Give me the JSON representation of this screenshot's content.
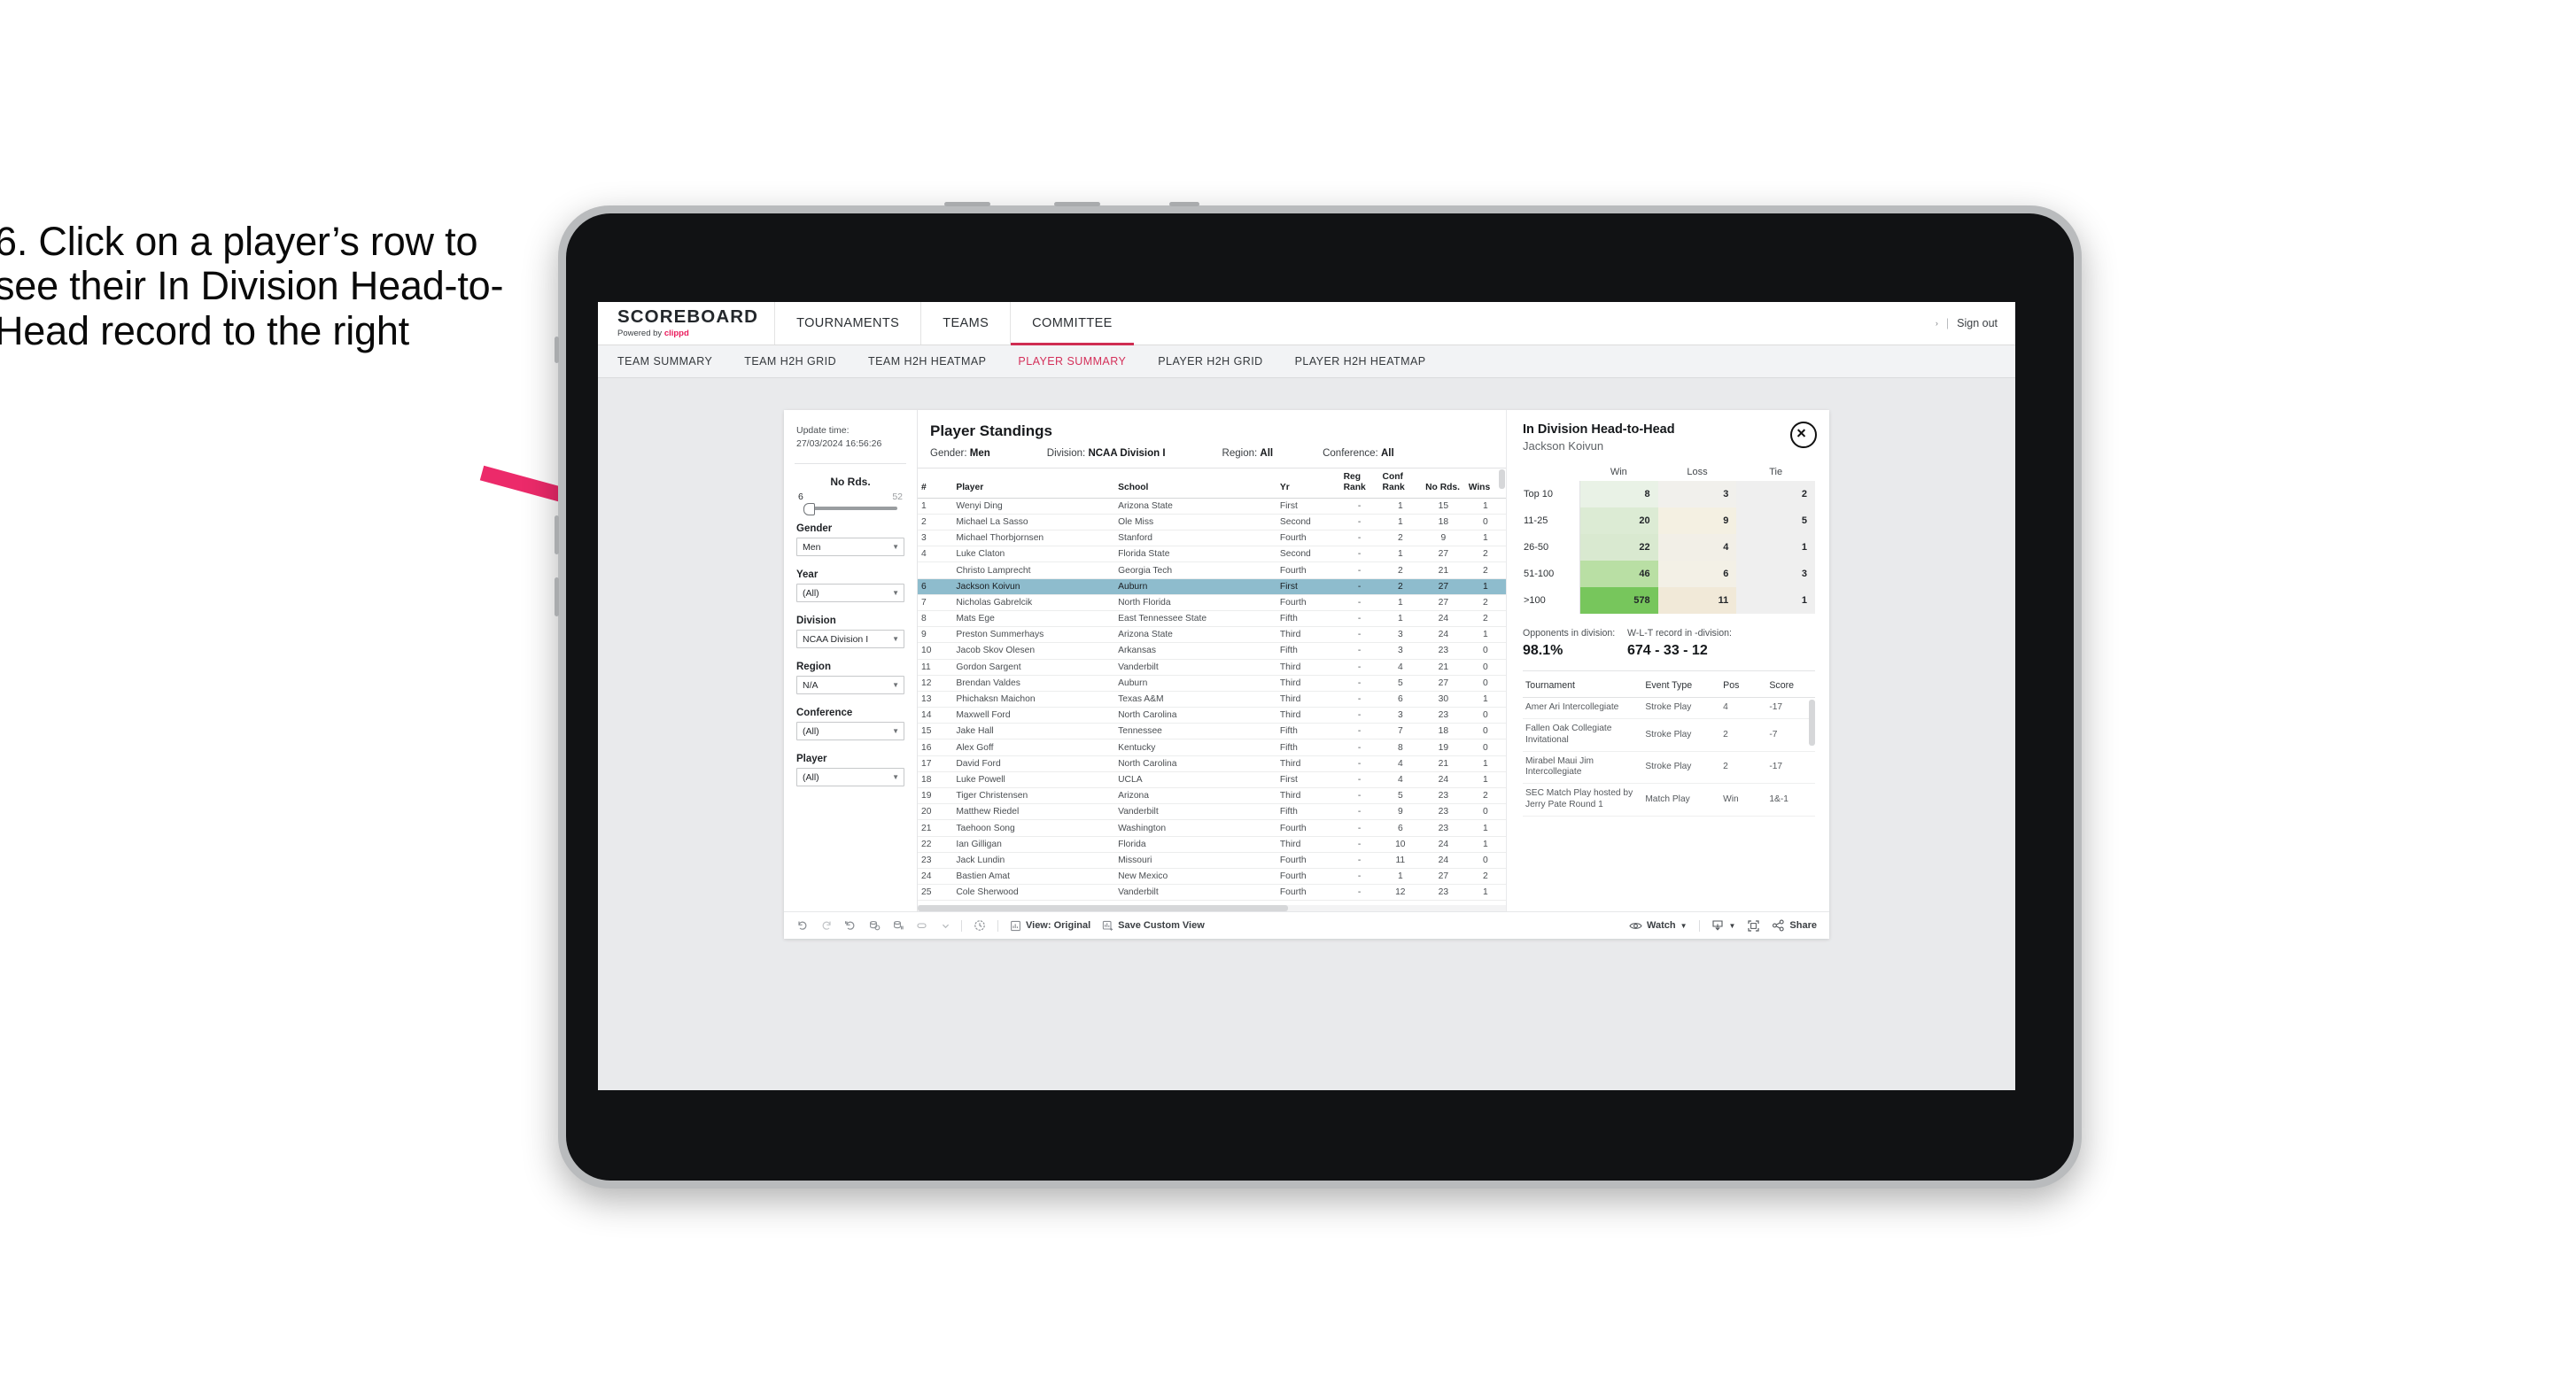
{
  "caption": "6. Click on a player’s row to see their In Division Head-to-Head record to the right",
  "header": {
    "brand_name": "SCOREBOARD",
    "brand_powered_prefix": "Powered by ",
    "brand_powered_name": "clippd",
    "nav": [
      {
        "label": "TOURNAMENTS",
        "active": false
      },
      {
        "label": "TEAMS",
        "active": false
      },
      {
        "label": "COMMITTEE",
        "active": true
      }
    ],
    "caret": "›",
    "separator": "|",
    "sign_out": "Sign out"
  },
  "subnav": [
    {
      "label": "TEAM SUMMARY",
      "active": false
    },
    {
      "label": "TEAM H2H GRID",
      "active": false
    },
    {
      "label": "TEAM H2H HEATMAP",
      "active": false
    },
    {
      "label": "PLAYER SUMMARY",
      "active": true
    },
    {
      "label": "PLAYER H2H GRID",
      "active": false
    },
    {
      "label": "PLAYER H2H HEATMAP",
      "active": false
    }
  ],
  "filters": {
    "update_label": "Update time:",
    "update_value": "27/03/2024 16:56:26",
    "slider": {
      "label": "No Rds.",
      "min": "6",
      "max": "52"
    },
    "controls": [
      {
        "label": "Gender",
        "value": "Men"
      },
      {
        "label": "Year",
        "value": "(All)"
      },
      {
        "label": "Division",
        "value": "NCAA Division I"
      },
      {
        "label": "Region",
        "value": "N/A"
      },
      {
        "label": "Conference",
        "value": "(All)"
      },
      {
        "label": "Player",
        "value": "(All)"
      }
    ]
  },
  "standings": {
    "title": "Player Standings",
    "meta": [
      {
        "label": "Gender:",
        "value": "Men"
      },
      {
        "label": "Division:",
        "value": "NCAA Division I"
      },
      {
        "label": "Region:",
        "value": "All"
      },
      {
        "label": "Conference:",
        "value": "All"
      }
    ],
    "columns": [
      "#",
      "Player",
      "School",
      "Yr",
      "Reg Rank",
      "Conf Rank",
      "No Rds.",
      "Wins"
    ],
    "rows": [
      {
        "num": "1",
        "player": "Wenyi Ding",
        "school": "Arizona State",
        "yr": "First",
        "reg": "-",
        "conf": "1",
        "rds": "15",
        "wins": "1",
        "selected": false
      },
      {
        "num": "2",
        "player": "Michael La Sasso",
        "school": "Ole Miss",
        "yr": "Second",
        "reg": "-",
        "conf": "1",
        "rds": "18",
        "wins": "0",
        "selected": false
      },
      {
        "num": "3",
        "player": "Michael Thorbjornsen",
        "school": "Stanford",
        "yr": "Fourth",
        "reg": "-",
        "conf": "2",
        "rds": "9",
        "wins": "1",
        "selected": false
      },
      {
        "num": "4",
        "player": "Luke Claton",
        "school": "Florida State",
        "yr": "Second",
        "reg": "-",
        "conf": "1",
        "rds": "27",
        "wins": "2",
        "selected": false
      },
      {
        "num": "",
        "player": "Christo Lamprecht",
        "school": "Georgia Tech",
        "yr": "Fourth",
        "reg": "-",
        "conf": "2",
        "rds": "21",
        "wins": "2",
        "selected": false
      },
      {
        "num": "6",
        "player": "Jackson Koivun",
        "school": "Auburn",
        "yr": "First",
        "reg": "-",
        "conf": "2",
        "rds": "27",
        "wins": "1",
        "selected": true
      },
      {
        "num": "7",
        "player": "Nicholas Gabrelcik",
        "school": "North Florida",
        "yr": "Fourth",
        "reg": "-",
        "conf": "1",
        "rds": "27",
        "wins": "2",
        "selected": false
      },
      {
        "num": "8",
        "player": "Mats Ege",
        "school": "East Tennessee State",
        "yr": "Fifth",
        "reg": "-",
        "conf": "1",
        "rds": "24",
        "wins": "2",
        "selected": false
      },
      {
        "num": "9",
        "player": "Preston Summerhays",
        "school": "Arizona State",
        "yr": "Third",
        "reg": "-",
        "conf": "3",
        "rds": "24",
        "wins": "1",
        "selected": false
      },
      {
        "num": "10",
        "player": "Jacob Skov Olesen",
        "school": "Arkansas",
        "yr": "Fifth",
        "reg": "-",
        "conf": "3",
        "rds": "23",
        "wins": "0",
        "selected": false
      },
      {
        "num": "11",
        "player": "Gordon Sargent",
        "school": "Vanderbilt",
        "yr": "Third",
        "reg": "-",
        "conf": "4",
        "rds": "21",
        "wins": "0",
        "selected": false
      },
      {
        "num": "12",
        "player": "Brendan Valdes",
        "school": "Auburn",
        "yr": "Third",
        "reg": "-",
        "conf": "5",
        "rds": "27",
        "wins": "0",
        "selected": false
      },
      {
        "num": "13",
        "player": "Phichaksn Maichon",
        "school": "Texas A&M",
        "yr": "Third",
        "reg": "-",
        "conf": "6",
        "rds": "30",
        "wins": "1",
        "selected": false
      },
      {
        "num": "14",
        "player": "Maxwell Ford",
        "school": "North Carolina",
        "yr": "Third",
        "reg": "-",
        "conf": "3",
        "rds": "23",
        "wins": "0",
        "selected": false
      },
      {
        "num": "15",
        "player": "Jake Hall",
        "school": "Tennessee",
        "yr": "Fifth",
        "reg": "-",
        "conf": "7",
        "rds": "18",
        "wins": "0",
        "selected": false
      },
      {
        "num": "16",
        "player": "Alex Goff",
        "school": "Kentucky",
        "yr": "Fifth",
        "reg": "-",
        "conf": "8",
        "rds": "19",
        "wins": "0",
        "selected": false
      },
      {
        "num": "17",
        "player": "David Ford",
        "school": "North Carolina",
        "yr": "Third",
        "reg": "-",
        "conf": "4",
        "rds": "21",
        "wins": "1",
        "selected": false
      },
      {
        "num": "18",
        "player": "Luke Powell",
        "school": "UCLA",
        "yr": "First",
        "reg": "-",
        "conf": "4",
        "rds": "24",
        "wins": "1",
        "selected": false
      },
      {
        "num": "19",
        "player": "Tiger Christensen",
        "school": "Arizona",
        "yr": "Third",
        "reg": "-",
        "conf": "5",
        "rds": "23",
        "wins": "2",
        "selected": false
      },
      {
        "num": "20",
        "player": "Matthew Riedel",
        "school": "Vanderbilt",
        "yr": "Fifth",
        "reg": "-",
        "conf": "9",
        "rds": "23",
        "wins": "0",
        "selected": false
      },
      {
        "num": "21",
        "player": "Taehoon Song",
        "school": "Washington",
        "yr": "Fourth",
        "reg": "-",
        "conf": "6",
        "rds": "23",
        "wins": "1",
        "selected": false
      },
      {
        "num": "22",
        "player": "Ian Gilligan",
        "school": "Florida",
        "yr": "Third",
        "reg": "-",
        "conf": "10",
        "rds": "24",
        "wins": "1",
        "selected": false
      },
      {
        "num": "23",
        "player": "Jack Lundin",
        "school": "Missouri",
        "yr": "Fourth",
        "reg": "-",
        "conf": "11",
        "rds": "24",
        "wins": "0",
        "selected": false
      },
      {
        "num": "24",
        "player": "Bastien Amat",
        "school": "New Mexico",
        "yr": "Fourth",
        "reg": "-",
        "conf": "1",
        "rds": "27",
        "wins": "2",
        "selected": false
      },
      {
        "num": "25",
        "player": "Cole Sherwood",
        "school": "Vanderbilt",
        "yr": "Fourth",
        "reg": "-",
        "conf": "12",
        "rds": "23",
        "wins": "1",
        "selected": false
      }
    ]
  },
  "h2h": {
    "title": "In Division Head-to-Head",
    "player": "Jackson Koivun",
    "close_icon": "close-icon",
    "columns": [
      "",
      "Win",
      "Loss",
      "Tie"
    ],
    "rows": [
      {
        "band": "Top 10",
        "win": "8",
        "loss": "3",
        "tie": "2",
        "win_color": "#e9f2e6",
        "loss_color": "#f1f0ec",
        "tie_color": "#efefef"
      },
      {
        "band": "11-25",
        "win": "20",
        "loss": "9",
        "tie": "5",
        "win_color": "#dcebd4",
        "loss_color": "#f4f0e2",
        "tie_color": "#efefef"
      },
      {
        "band": "26-50",
        "win": "22",
        "loss": "4",
        "tie": "1",
        "win_color": "#d9e9d0",
        "loss_color": "#f2efe7",
        "tie_color": "#efefef"
      },
      {
        "band": "51-100",
        "win": "46",
        "loss": "6",
        "tie": "3",
        "win_color": "#b9dfa4",
        "loss_color": "#f3f0e6",
        "tie_color": "#efefef"
      },
      {
        "band": ">100",
        "win": "578",
        "loss": "11",
        "tie": "1",
        "win_color": "#77c65c",
        "loss_color": "#f1e9d8",
        "tie_color": "#efefef"
      }
    ],
    "stats": [
      {
        "label": "Opponents in division:",
        "value": "98.1%"
      },
      {
        "label": "W-L-T record in -division:",
        "value": "674 - 33 - 12"
      }
    ],
    "tournament_columns": [
      "Tournament",
      "Event Type",
      "Pos",
      "Score"
    ],
    "tournaments": [
      {
        "name": "Amer Ari Intercollegiate",
        "type": "Stroke Play",
        "pos": "4",
        "score": "-17"
      },
      {
        "name": "Fallen Oak Collegiate Invitational",
        "type": "Stroke Play",
        "pos": "2",
        "score": "-7"
      },
      {
        "name": "Mirabel Maui Jim Intercollegiate",
        "type": "Stroke Play",
        "pos": "2",
        "score": "-17"
      },
      {
        "name": "SEC Match Play hosted by Jerry Pate Round 1",
        "type": "Match Play",
        "pos": "Win",
        "score": "1&-1"
      }
    ]
  },
  "toolbar_left": {
    "icons": [
      "undo-icon",
      "redo-icon",
      "revert-icon",
      "refresh-data-icon",
      "pause-updates-icon",
      "highlight-icon",
      "dropdown-caret-icon",
      "clock-icon"
    ],
    "view_label": "View: Original",
    "save_label": "Save Custom View"
  },
  "toolbar_right": {
    "watch_label": "Watch",
    "download_icon": "download-icon",
    "fullscreen_icon": "fullscreen-icon",
    "share_label": "Share"
  },
  "colors": {
    "accent": "#cf2d52",
    "brand_pink": "#ea1b5c",
    "selection": "#8ebccd",
    "arrow": "#ec2a6a"
  }
}
